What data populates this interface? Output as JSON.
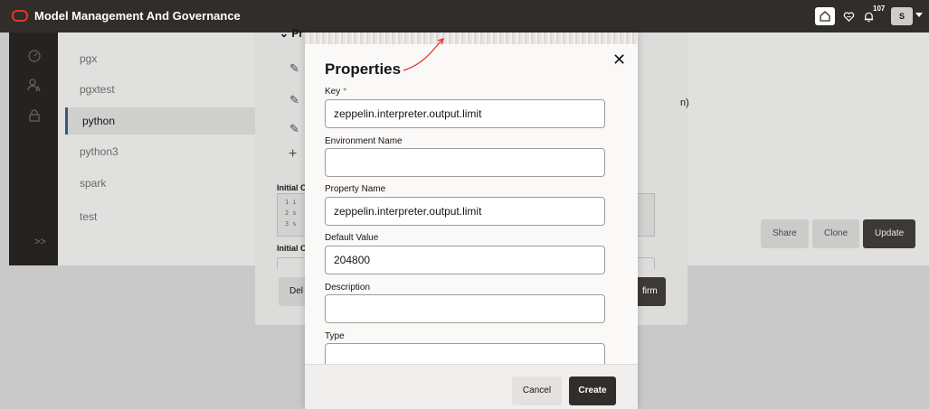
{
  "header": {
    "app_title": "Model Management And Governance",
    "notification_count": "107",
    "user_initial": "S"
  },
  "rail": {
    "icons": [
      "dashboard-icon",
      "users-icon",
      "lock-icon"
    ],
    "expand_label": ">>"
  },
  "interpreters": {
    "items": [
      {
        "label": "pgx",
        "selected": false
      },
      {
        "label": "pgxtest",
        "selected": false
      },
      {
        "label": "python",
        "selected": true
      },
      {
        "label": "python3",
        "selected": false
      },
      {
        "label": "spark",
        "selected": false
      },
      {
        "label": "test",
        "selected": false
      }
    ]
  },
  "actions": {
    "share": "Share",
    "clone": "Clone",
    "update": "Update"
  },
  "back_dialog": {
    "section_label": "Pr",
    "initial_label_1": "Initial C",
    "code_lines": [
      "1 i",
      "2 s",
      "3 s"
    ],
    "initial_label_2": "Initial C",
    "delete_label": "Del",
    "confirm_label": "firm",
    "partial_text": "n)"
  },
  "properties_dialog": {
    "title": "Properties",
    "key_label": "Key",
    "required_mark": "*",
    "key_value": "zeppelin.interpreter.output.limit",
    "environment_label": "Environment Name",
    "environment_value": "",
    "property_name_label": "Property Name",
    "property_name_value": "zeppelin.interpreter.output.limit",
    "default_value_label": "Default Value",
    "default_value": "204800",
    "description_label": "Description",
    "description_value": "",
    "type_label": "Type",
    "type_value": "",
    "cancel_label": "Cancel",
    "create_label": "Create"
  },
  "colors": {
    "header_bg": "#312d2a",
    "brand_red": "#e2342b",
    "primary_button": "#312d2a",
    "required_marker": "#2a8d6a"
  }
}
